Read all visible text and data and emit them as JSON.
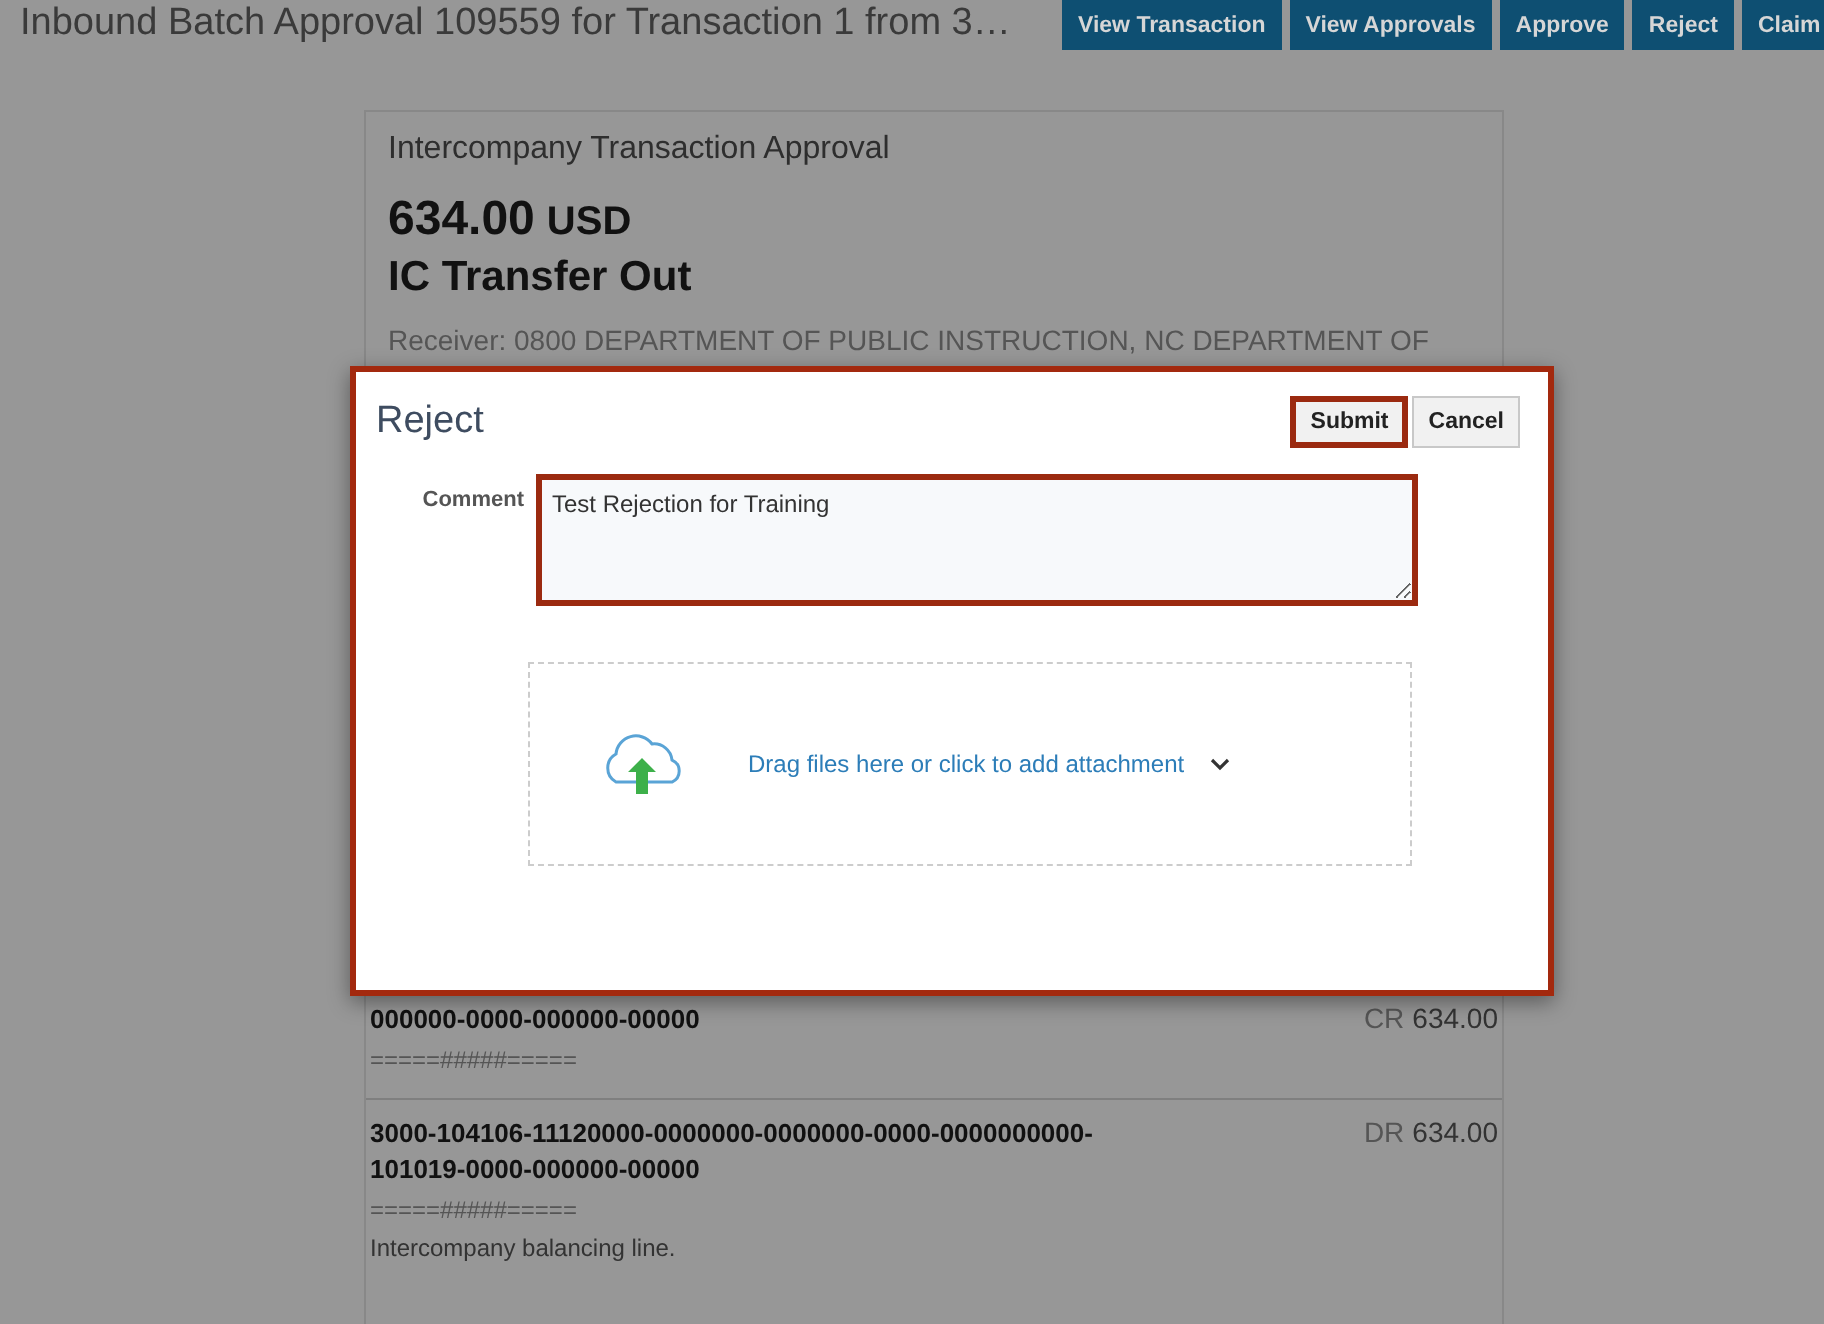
{
  "header": {
    "title": "Inbound Batch Approval 109559 for Transaction 1 from 3…",
    "buttons": [
      "View Transaction",
      "View Approvals",
      "Approve",
      "Reject",
      "Claim"
    ]
  },
  "card": {
    "heading": "Intercompany Transaction Approval",
    "amount": "634.00",
    "currency": "USD",
    "type": "IC Transfer Out",
    "receiver": "Receiver: 0800 DEPARTMENT OF PUBLIC INSTRUCTION, NC DEPARTMENT OF",
    "lines": [
      {
        "account": "000000-0000-000000-00000",
        "pattern": "=====#####=====",
        "side": "CR",
        "amount": "634.00"
      },
      {
        "account": "3000-104106-11120000-0000000-0000000-0000-0000000000-101019-0000-000000-00000",
        "pattern": "=====#####=====",
        "side": "DR",
        "amount": "634.00",
        "note": "Intercompany balancing line."
      }
    ]
  },
  "dialog": {
    "title": "Reject",
    "highlighted": true,
    "buttons": [
      {
        "label": "Submit",
        "highlighted": true
      },
      {
        "label": "Cancel",
        "highlighted": false
      }
    ],
    "comment": {
      "label": "Comment",
      "value": "Test Rejection for Training",
      "highlighted": true
    },
    "attachment": {
      "label": "Drag files here or click to add attachment"
    }
  }
}
